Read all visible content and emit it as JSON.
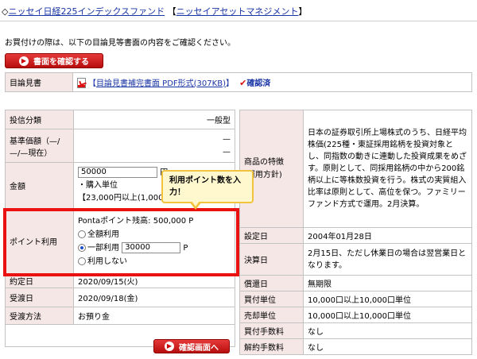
{
  "header": {
    "prefix": "◇",
    "fund_name": "ニッセイ日経225インデックスファンド",
    "bracket_open": "【",
    "company": "ニッセイアセットマネジメント",
    "bracket_close": "】"
  },
  "notice": "お買付けの際は、以下の目論見等書面の内容をご確認ください。",
  "doc_button_label": "書面を確認する",
  "mokuromi": {
    "label": "目論見書",
    "link_open": "【",
    "link_text": "目論見書補完書面 PDF形式(307KB)",
    "link_close": "】",
    "status": "確認済"
  },
  "left": {
    "rows": [
      {
        "label": "投信分類",
        "value": "一般型"
      },
      {
        "label": "基準価額（—/—/—現在）",
        "value1": "—",
        "value2": "—"
      }
    ],
    "amount": {
      "label": "金額",
      "input_value": "50000",
      "input_suffix": "円",
      "unit_label": "・購入単位",
      "range_note": "【23,000円以上(1,000円"
    },
    "points": {
      "label": "ポイント利用",
      "balance": "Pontaポイント残高: 500,000 P",
      "opt_all": "全額利用",
      "opt_partial": "一部利用",
      "partial_value": "30000",
      "partial_unit": "P",
      "opt_none": "利用しない"
    },
    "rows2": [
      {
        "label": "約定日",
        "value": "2020/09/15(火)"
      },
      {
        "label": "受渡日",
        "value": "2020/09/18(金)"
      },
      {
        "label": "受渡方法",
        "value": "お預り金"
      }
    ]
  },
  "right": {
    "feature_label": "商品の特徴\n(運用方針)",
    "feature_text": "日本の証券取引所上場株式のうち、日経平均株価(225種・東証採用銘柄を投資対象とし、同指数の動きに連動した投資成果をめざす。原則として、同採用銘柄の中から200銘柄以上に等株数投資を行う。株式の実質組入比率は原則として、高位を保つ。ファミリーファンド方式で運用。2月決算。",
    "rows": [
      {
        "label": "設定日",
        "value": "2004年01月28日"
      },
      {
        "label": "決算日",
        "value": "2月15日、ただし休業日の場合は翌営業日となります。"
      },
      {
        "label": "償還日",
        "value": "無期限"
      },
      {
        "label": "買付単位",
        "value": "10,000口以上10,000口単位"
      },
      {
        "label": "売却単位",
        "value": "10,000口以上10,000口単位"
      },
      {
        "label": "買付手数料",
        "value": "なし"
      },
      {
        "label": "解約手数料",
        "value": "なし"
      }
    ]
  },
  "callout": "利用ポイント数を入力！",
  "confirm_button_label": "確認画面へ"
}
